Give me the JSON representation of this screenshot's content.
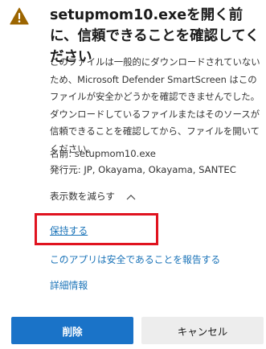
{
  "dialog": {
    "title": "setupmom10.exeを開く前に、信頼できることを確認してください",
    "description": "このファイルは一般的にダウンロードされていないため、Microsoft Defender SmartScreen はこのファイルが安全かどうかを確認できませんでした。ダウンロードしているファイルまたはそのソースが信頼できることを確認してから、ファイルを開いてください。",
    "file_name": "名前: setupmom10.exe",
    "publisher": "発行元: JP, Okayama, Okayama, SANTEC",
    "show_less_label": "表示数を減らす",
    "keep_label": "保持する",
    "report_label": "このアプリは安全であることを報告する",
    "details_label": "詳細情報",
    "delete_label": "削除",
    "cancel_label": "キャンセル"
  },
  "icons": {
    "warning": "warning-icon",
    "chevron": "chevron-up-icon"
  },
  "colors": {
    "warning_fill": "#9c6500",
    "link": "#1a73b8",
    "primary_button": "#1a73c8",
    "highlight_box": "#e0131f"
  }
}
